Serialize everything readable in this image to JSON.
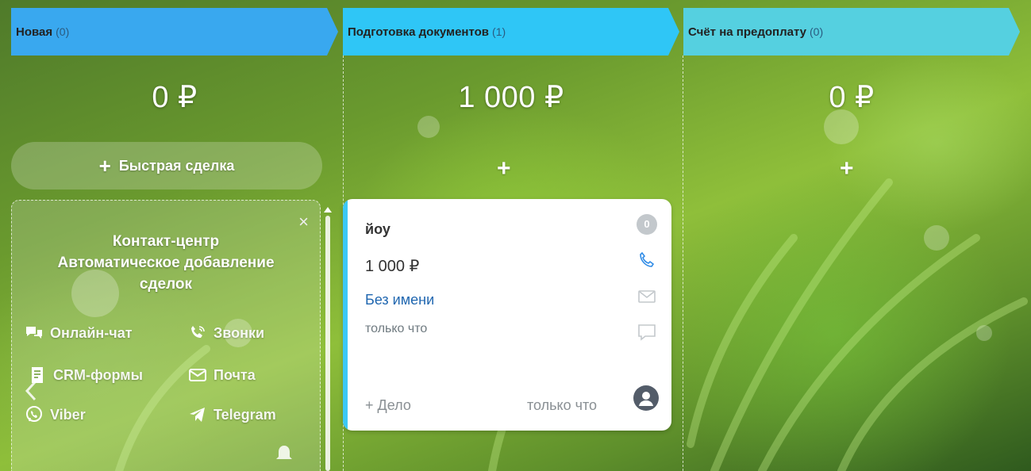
{
  "columns": [
    {
      "title": "Новая",
      "count": "(0)",
      "sum": "0 ₽",
      "color": "#39a8ef"
    },
    {
      "title": "Подготовка документов",
      "count": "(1)",
      "sum": "1 000 ₽",
      "color": "#2fc6f6"
    },
    {
      "title": "Счёт на предоплату",
      "count": "(0)",
      "sum": "0 ₽",
      "color": "#55d0e0"
    }
  ],
  "quick_deal": {
    "plus": "+",
    "label": "Быстрая сделка"
  },
  "add_plus": "+",
  "promo": {
    "close": "×",
    "title_line1": "Контакт-центр",
    "title_line2": "Автоматическое добавление",
    "title_line3": "сделок",
    "channels": [
      "Онлайн-чат",
      "Звонки",
      "CRM-формы",
      "Почта",
      "Viber",
      "Telegram"
    ]
  },
  "deal": {
    "name": "йоу",
    "price": "1 000 ₽",
    "contact": "Без имени",
    "created": "только что",
    "activity_count": "0",
    "add_task": "+ Дело",
    "last_activity": "только что"
  }
}
